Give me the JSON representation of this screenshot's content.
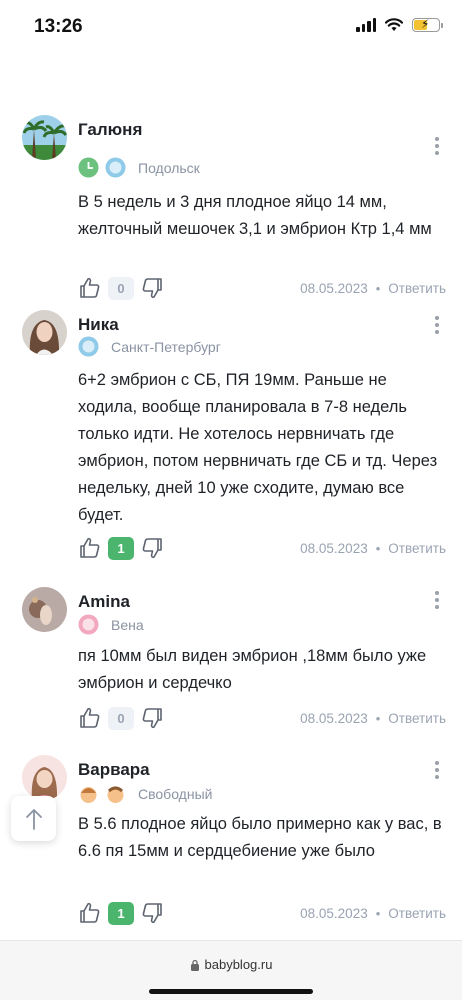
{
  "status_bar": {
    "time": "13:26"
  },
  "comments": [
    {
      "author": "Галюня",
      "city": "Подольск",
      "text": "В 5 недель и 3 дня плодное яйцо 14 мм, желточный мешочек 3,1 и эмбрион Ктр 1,4 мм",
      "likes": "0",
      "date": "08.05.2023",
      "reply": "Ответить",
      "sep": "•"
    },
    {
      "author": "Ника",
      "city": "Санкт-Петербург",
      "text": "6+2 эмбрион с СБ, ПЯ 19мм. Раньше не ходила, вообще планировала в 7-8 недель только идти. Не хотелось нервничать где эмбрион, потом нервничать где СБ и тд. Через недельку, дней 10 уже сходите, думаю все будет.",
      "likes": "1",
      "date": "08.05.2023",
      "reply": "Ответить",
      "sep": "•"
    },
    {
      "author": "Amina",
      "city": "Вена",
      "text": "пя 10мм был виден эмбрион ,18мм было уже эмбрион и сердечко",
      "likes": "0",
      "date": "08.05.2023",
      "reply": "Ответить",
      "sep": "•"
    },
    {
      "author": "Варвара",
      "city": "Свободный",
      "text": "В 5.6 плодное яйцо было примерно как у вас, в 6.6 пя 15мм и сердцебиение уже было",
      "likes": "1",
      "date": "08.05.2023",
      "reply": "Ответить",
      "sep": "•"
    }
  ],
  "browser": {
    "url": "babyblog.ru"
  },
  "colors": {
    "like_positive": "#4bb56e",
    "muted": "#9aa3b2"
  }
}
